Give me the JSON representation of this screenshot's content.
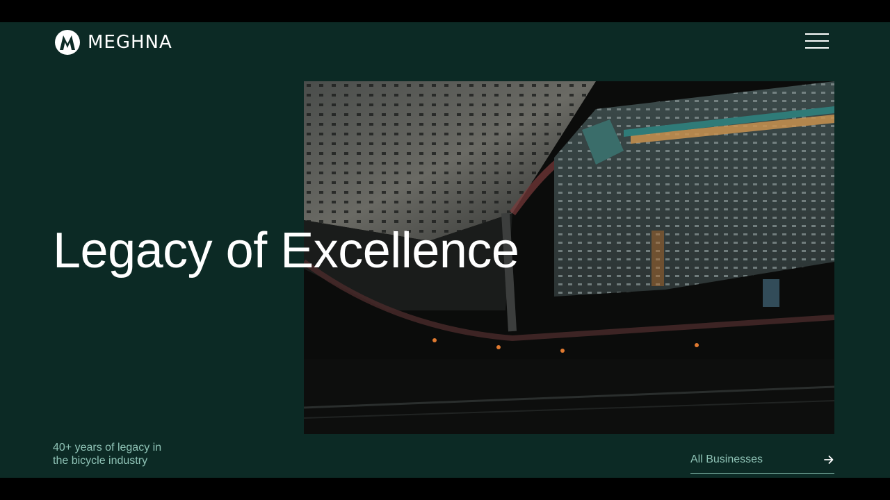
{
  "brand": {
    "name": "MEGHNA",
    "logo_icon": "m-monogram-icon"
  },
  "header": {
    "menu_icon": "hamburger-menu-icon"
  },
  "hero": {
    "title": "Legacy of Excellence",
    "image_description_icon": "aerial-city-photo"
  },
  "tagline": "40+ years of legacy in the bicycle industry",
  "cta": {
    "label": "All Businesses",
    "icon": "arrow-right-icon"
  },
  "colors": {
    "background": "#0c2a25",
    "text_primary": "#ffffff",
    "text_accent": "#8fc3b6",
    "letterbox": "#000000"
  }
}
